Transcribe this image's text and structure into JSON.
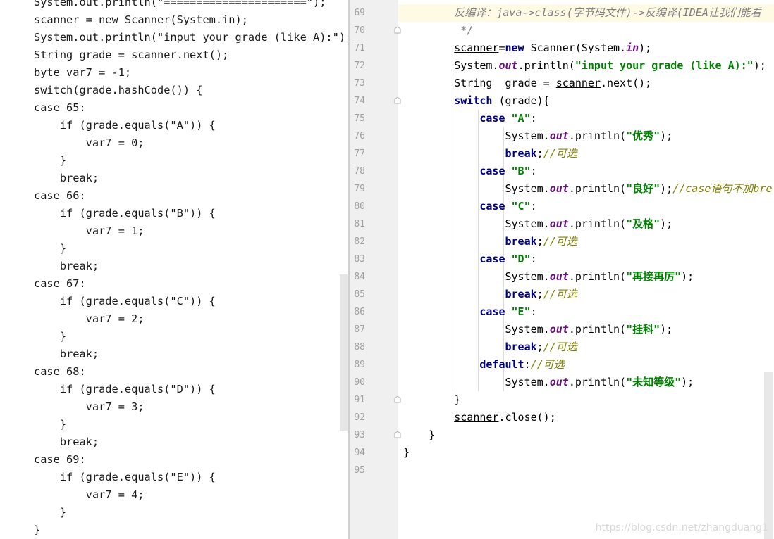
{
  "left_panel": {
    "lines": [
      "System.out.println(\"======================\");",
      "scanner = new Scanner(System.in);",
      "System.out.println(\"input your grade (like A):\");",
      "String grade = scanner.next();",
      "byte var7 = -1;",
      "switch(grade.hashCode()) {",
      "case 65:",
      "    if (grade.equals(\"A\")) {",
      "        var7 = 0;",
      "    }",
      "    break;",
      "case 66:",
      "    if (grade.equals(\"B\")) {",
      "        var7 = 1;",
      "    }",
      "    break;",
      "case 67:",
      "    if (grade.equals(\"C\")) {",
      "        var7 = 2;",
      "    }",
      "    break;",
      "case 68:",
      "    if (grade.equals(\"D\")) {",
      "        var7 = 3;",
      "    }",
      "    break;",
      "case 69:",
      "    if (grade.equals(\"E\")) {",
      "        var7 = 4;",
      "    }",
      "}"
    ]
  },
  "editor": {
    "line_numbers": [
      "69",
      "70",
      "71",
      "72",
      "73",
      "74",
      "75",
      "76",
      "77",
      "78",
      "79",
      "80",
      "81",
      "82",
      "83",
      "84",
      "85",
      "86",
      "87",
      "88",
      "89",
      "90",
      "91",
      "92",
      "93",
      "94",
      "95"
    ],
    "lines": [
      [
        {
          "t": "        "
        },
        {
          "t": "反编译：java->class(字节码文件)->反编译(IDEA让我们能看",
          "c": "cm"
        }
      ],
      [
        {
          "t": "         "
        },
        {
          "t": "*/",
          "c": "cm"
        }
      ],
      [
        {
          "t": "        "
        },
        {
          "t": "scanner",
          "c": "ul"
        },
        {
          "t": "="
        },
        {
          "t": "new",
          "c": "kw"
        },
        {
          "t": " Scanner(System."
        },
        {
          "t": "in",
          "c": "fld"
        },
        {
          "t": ");"
        }
      ],
      [
        {
          "t": "        System."
        },
        {
          "t": "out",
          "c": "fld"
        },
        {
          "t": ".println("
        },
        {
          "t": "\"input your grade (like A):\"",
          "c": "str"
        },
        {
          "t": ");"
        }
      ],
      [
        {
          "t": "        String  grade = "
        },
        {
          "t": "scanner",
          "c": "ul"
        },
        {
          "t": ".next();"
        }
      ],
      [
        {
          "t": "        "
        },
        {
          "t": "switch",
          "c": "kw"
        },
        {
          "t": " (grade){"
        }
      ],
      [
        {
          "t": "            "
        },
        {
          "t": "case",
          "c": "kw"
        },
        {
          "t": " "
        },
        {
          "t": "\"A\"",
          "c": "str"
        },
        {
          "t": ":"
        }
      ],
      [
        {
          "t": "                System."
        },
        {
          "t": "out",
          "c": "fld"
        },
        {
          "t": ".println("
        },
        {
          "t": "\"优秀\"",
          "c": "str"
        },
        {
          "t": ");"
        }
      ],
      [
        {
          "t": "                "
        },
        {
          "t": "break",
          "c": "kw"
        },
        {
          "t": ";"
        },
        {
          "t": "//可选",
          "c": "tc"
        }
      ],
      [
        {
          "t": "            "
        },
        {
          "t": "case",
          "c": "kw"
        },
        {
          "t": " "
        },
        {
          "t": "\"B\"",
          "c": "str"
        },
        {
          "t": ":"
        }
      ],
      [
        {
          "t": "                System."
        },
        {
          "t": "out",
          "c": "fld"
        },
        {
          "t": ".println("
        },
        {
          "t": "\"良好\"",
          "c": "str"
        },
        {
          "t": ");"
        },
        {
          "t": "//case语句不加bre",
          "c": "tc"
        }
      ],
      [
        {
          "t": "            "
        },
        {
          "t": "case",
          "c": "kw"
        },
        {
          "t": " "
        },
        {
          "t": "\"C\"",
          "c": "str"
        },
        {
          "t": ":"
        }
      ],
      [
        {
          "t": "                System."
        },
        {
          "t": "out",
          "c": "fld"
        },
        {
          "t": ".println("
        },
        {
          "t": "\"及格\"",
          "c": "str"
        },
        {
          "t": ");"
        }
      ],
      [
        {
          "t": "                "
        },
        {
          "t": "break",
          "c": "kw"
        },
        {
          "t": ";"
        },
        {
          "t": "//可选",
          "c": "tc"
        }
      ],
      [
        {
          "t": "            "
        },
        {
          "t": "case",
          "c": "kw"
        },
        {
          "t": " "
        },
        {
          "t": "\"D\"",
          "c": "str"
        },
        {
          "t": ":"
        }
      ],
      [
        {
          "t": "                System."
        },
        {
          "t": "out",
          "c": "fld"
        },
        {
          "t": ".println("
        },
        {
          "t": "\"再接再厉\"",
          "c": "str"
        },
        {
          "t": ");"
        }
      ],
      [
        {
          "t": "                "
        },
        {
          "t": "break",
          "c": "kw"
        },
        {
          "t": ";"
        },
        {
          "t": "//可选",
          "c": "tc"
        }
      ],
      [
        {
          "t": "            "
        },
        {
          "t": "case",
          "c": "kw"
        },
        {
          "t": " "
        },
        {
          "t": "\"E\"",
          "c": "str"
        },
        {
          "t": ":"
        }
      ],
      [
        {
          "t": "                System."
        },
        {
          "t": "out",
          "c": "fld"
        },
        {
          "t": ".println("
        },
        {
          "t": "\"挂科\"",
          "c": "str"
        },
        {
          "t": ");"
        }
      ],
      [
        {
          "t": "                "
        },
        {
          "t": "break",
          "c": "kw"
        },
        {
          "t": ";"
        },
        {
          "t": "//可选",
          "c": "tc"
        }
      ],
      [
        {
          "t": "            "
        },
        {
          "t": "default",
          "c": "kw"
        },
        {
          "t": ":"
        },
        {
          "t": "//可选",
          "c": "tc"
        }
      ],
      [
        {
          "t": "                System."
        },
        {
          "t": "out",
          "c": "fld"
        },
        {
          "t": ".println("
        },
        {
          "t": "\"未知等级\"",
          "c": "str"
        },
        {
          "t": ");"
        }
      ],
      [
        {
          "t": "        }"
        }
      ],
      [
        {
          "t": "        "
        },
        {
          "t": "scanner",
          "c": "ul"
        },
        {
          "t": ".close();"
        }
      ],
      [
        {
          "t": "    }"
        }
      ],
      [
        {
          "t": "}"
        }
      ],
      [
        {
          "t": ""
        }
      ]
    ],
    "highlighted_line": "69"
  },
  "watermark": "https://blog.csdn.net/zhangduang1",
  "colors": {
    "keyword": "#000080",
    "string": "#008000",
    "static_field": "#660e7a",
    "comment": "#808080",
    "todo_comment": "#808000",
    "current_line": "#fffae3",
    "gutter": "#f0f0f0"
  }
}
